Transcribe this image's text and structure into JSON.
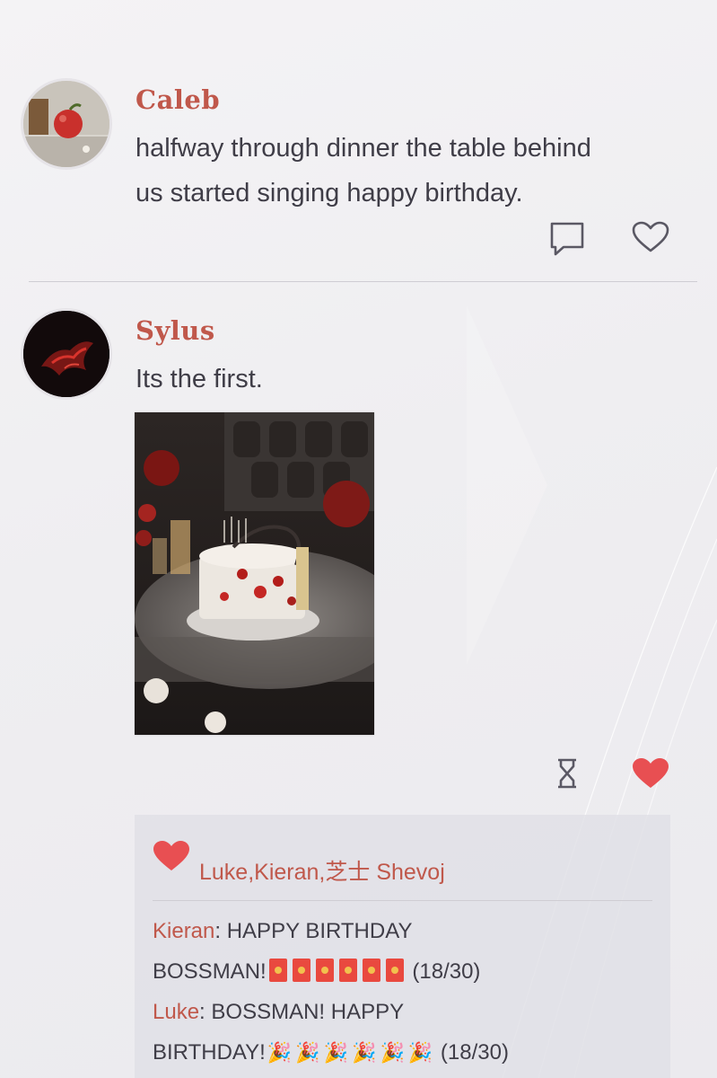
{
  "posts": [
    {
      "author": "Caleb",
      "text_lines": [
        "halfway through dinner the table behind",
        "us started singing happy birthday."
      ],
      "liked": false
    },
    {
      "author": "Sylus",
      "text_lines": [
        "Its the first."
      ],
      "liked": true,
      "likers": "Luke,Kieran,芝士 Shevoj",
      "comments": [
        {
          "author": "Kieran",
          "line1": "HAPPY BIRTHDAY",
          "line2": "BOSSMAN!",
          "emoji": "red-envelope",
          "emoji_count": 6,
          "count": "(18/30)"
        },
        {
          "author": "Luke",
          "line1": "BOSSMAN! HAPPY",
          "line2": "BIRTHDAY!",
          "emoji": "party-popper",
          "emoji_count": 6,
          "count": "(18/30)"
        }
      ]
    }
  ],
  "colors": {
    "accent": "#c0584b",
    "heart": "#e84f52",
    "text": "#3f3d47",
    "icon": "#5a5864"
  },
  "icons": {
    "comment": "comment-icon",
    "like": "heart-outline-icon",
    "liked": "heart-filled-icon",
    "pending": "hourglass-icon"
  }
}
